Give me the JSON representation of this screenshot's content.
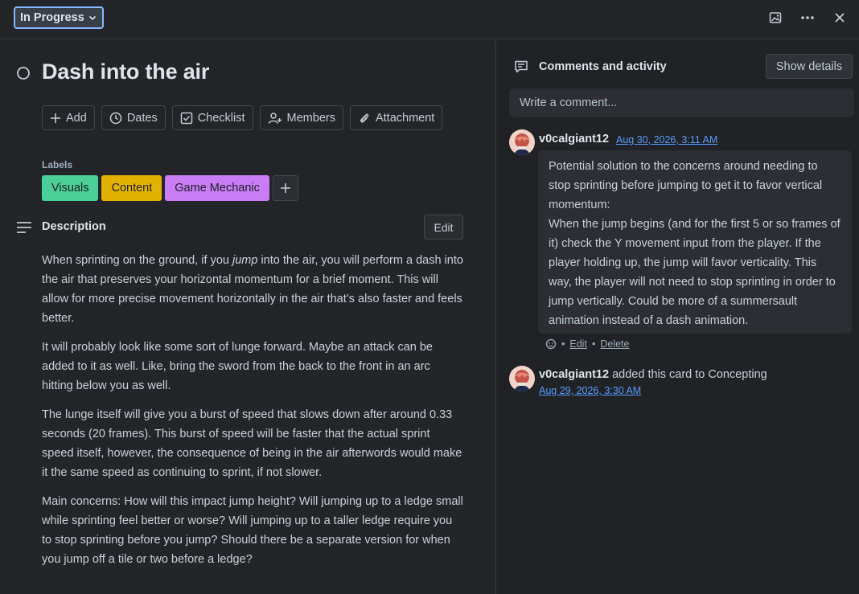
{
  "header": {
    "status_label": "In Progress",
    "icons": [
      "image-icon",
      "more-icon",
      "close-icon"
    ]
  },
  "card": {
    "title": "Dash into the air",
    "actions": [
      {
        "label": "Add",
        "icon": "plus-icon"
      },
      {
        "label": "Dates",
        "icon": "clock-icon"
      },
      {
        "label": "Checklist",
        "icon": "checkbox-icon"
      },
      {
        "label": "Members",
        "icon": "add-person-icon"
      },
      {
        "label": "Attachment",
        "icon": "paperclip-icon"
      }
    ],
    "labels_heading": "Labels",
    "labels": [
      {
        "name": "Visuals",
        "color": "#4bce97"
      },
      {
        "name": "Content",
        "color": "#e2b203"
      },
      {
        "name": "Game Mechanic",
        "color": "#c97cf4"
      }
    ],
    "description_heading": "Description",
    "edit_label": "Edit",
    "description": {
      "p1_a": "When sprinting on the ground, if you ",
      "p1_em": "jump",
      "p1_b": " into the air, you will perform a dash into the air that preserves your horizontal momentum for a brief moment. This will allow for more precise movement horizontally in the air that’s also faster and feels better.",
      "p2": "It will probably look like some sort of lunge forward. Maybe an attack can be added to it as well. Like, bring the sword from the back to the front in an arc hitting below you as well.",
      "p3": "The lunge itself will give you a burst of speed that slows down after around 0.33 seconds (20 frames). This burst of speed will be faster that the actual sprint speed itself, however, the consequence of being in the air afterwords would make it the same speed as continuing to sprint, if not slower.",
      "p4": "Main concerns: How will this impact jump height? Will jumping up to a ledge small while sprinting feel better or worse? Will jumping up to a taller ledge require you to stop sprinting before you jump? Should there be a separate version for when you jump off a tile or two before a ledge?"
    }
  },
  "activity": {
    "heading": "Comments and activity",
    "show_details_label": "Show details",
    "comment_placeholder": "Write a comment...",
    "comment": {
      "user": "v0calgiant12",
      "time": "Aug 30, 2026, 3:11 AM",
      "text_l1": "Potential solution to the concerns around needing to stop sprinting before jumping to get it to favor vertical momentum:",
      "text_l2": "When the jump begins (and for the first 5 or so frames of it) check the Y movement input from the player. If the player holding up, the jump will favor verticality. This way, the player will not need to stop sprinting in order to jump vertically. Could be more of a summersault animation instead of a dash animation.",
      "sep": "•",
      "edit_label": "Edit",
      "delete_label": "Delete"
    },
    "event": {
      "user": "v0calgiant12",
      "text": " added this card to Concepting",
      "time": "Aug 29, 2026, 3:30 AM"
    }
  }
}
